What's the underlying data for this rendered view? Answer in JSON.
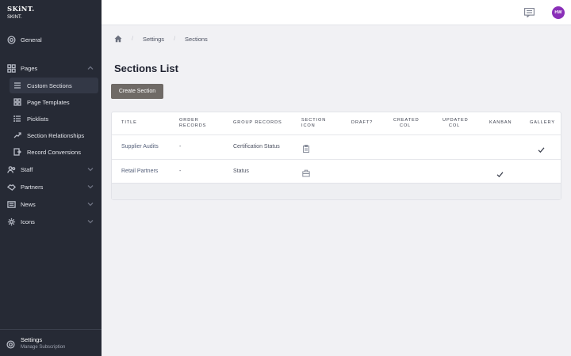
{
  "brand": {
    "logo": "SKiNT.",
    "name": "SKINT."
  },
  "sidebar": {
    "items": [
      {
        "label": "General",
        "icon": "gear-icon"
      },
      {
        "label": "Pages",
        "icon": "grid-icon"
      },
      {
        "label": "Staff",
        "icon": "users-icon"
      },
      {
        "label": "Partners",
        "icon": "handshake-icon"
      },
      {
        "label": "News",
        "icon": "newspaper-icon"
      },
      {
        "label": "Icons",
        "icon": "gear-icon"
      }
    ],
    "pages_sub": [
      {
        "label": "Custom Sections",
        "icon": "list-icon"
      },
      {
        "label": "Page Templates",
        "icon": "grid-icon"
      },
      {
        "label": "Picklists",
        "icon": "list-icon"
      },
      {
        "label": "Section Relationships",
        "icon": "link-icon"
      },
      {
        "label": "Record Conversions",
        "icon": "convert-icon"
      }
    ],
    "footer": {
      "title": "Settings",
      "subtitle": "Manage Subscription"
    }
  },
  "topbar": {
    "avatar_initials": "HW"
  },
  "breadcrumb": {
    "items": [
      "Settings",
      "Sections"
    ],
    "sep": "/"
  },
  "page": {
    "title": "Sections List",
    "create_label": "Create Section"
  },
  "table": {
    "headers": {
      "title": "TITLE",
      "order_records": [
        "ORDER",
        "RECORDS"
      ],
      "group_records": "GROUP RECORDS",
      "section_icon": [
        "SECTION",
        "ICON"
      ],
      "draft": "DRAFT?",
      "created_col": [
        "CREATED",
        "COL"
      ],
      "updated_col": [
        "UPDATED",
        "COL"
      ],
      "kanban": "KANBAN",
      "gallery": "GALLERY"
    },
    "rows": [
      {
        "title": "Supplier Audits",
        "order": "-",
        "group": "Certification Status",
        "icon": "clipboard-icon",
        "kanban": false,
        "gallery": true
      },
      {
        "title": "Retail Partners",
        "order": "-",
        "group": "Status",
        "icon": "briefcase-icon",
        "kanban": true,
        "gallery": false
      }
    ]
  }
}
